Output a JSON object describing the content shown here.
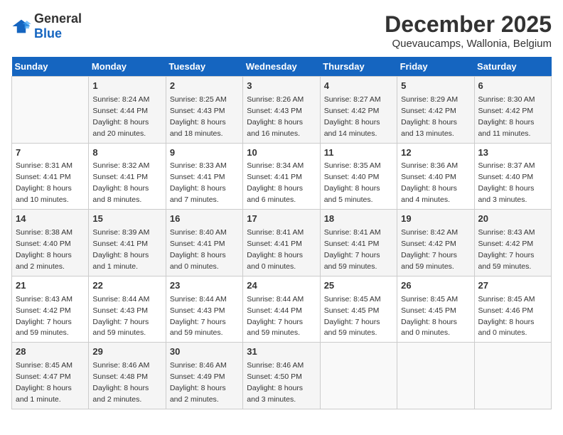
{
  "logo": {
    "general": "General",
    "blue": "Blue"
  },
  "title": "December 2025",
  "subtitle": "Quevaucamps, Wallonia, Belgium",
  "weekdays": [
    "Sunday",
    "Monday",
    "Tuesday",
    "Wednesday",
    "Thursday",
    "Friday",
    "Saturday"
  ],
  "weeks": [
    [
      {
        "day": "",
        "sunrise": "",
        "sunset": "",
        "daylight": ""
      },
      {
        "day": "1",
        "sunrise": "Sunrise: 8:24 AM",
        "sunset": "Sunset: 4:44 PM",
        "daylight": "Daylight: 8 hours and 20 minutes."
      },
      {
        "day": "2",
        "sunrise": "Sunrise: 8:25 AM",
        "sunset": "Sunset: 4:43 PM",
        "daylight": "Daylight: 8 hours and 18 minutes."
      },
      {
        "day": "3",
        "sunrise": "Sunrise: 8:26 AM",
        "sunset": "Sunset: 4:43 PM",
        "daylight": "Daylight: 8 hours and 16 minutes."
      },
      {
        "day": "4",
        "sunrise": "Sunrise: 8:27 AM",
        "sunset": "Sunset: 4:42 PM",
        "daylight": "Daylight: 8 hours and 14 minutes."
      },
      {
        "day": "5",
        "sunrise": "Sunrise: 8:29 AM",
        "sunset": "Sunset: 4:42 PM",
        "daylight": "Daylight: 8 hours and 13 minutes."
      },
      {
        "day": "6",
        "sunrise": "Sunrise: 8:30 AM",
        "sunset": "Sunset: 4:42 PM",
        "daylight": "Daylight: 8 hours and 11 minutes."
      }
    ],
    [
      {
        "day": "7",
        "sunrise": "Sunrise: 8:31 AM",
        "sunset": "Sunset: 4:41 PM",
        "daylight": "Daylight: 8 hours and 10 minutes."
      },
      {
        "day": "8",
        "sunrise": "Sunrise: 8:32 AM",
        "sunset": "Sunset: 4:41 PM",
        "daylight": "Daylight: 8 hours and 8 minutes."
      },
      {
        "day": "9",
        "sunrise": "Sunrise: 8:33 AM",
        "sunset": "Sunset: 4:41 PM",
        "daylight": "Daylight: 8 hours and 7 minutes."
      },
      {
        "day": "10",
        "sunrise": "Sunrise: 8:34 AM",
        "sunset": "Sunset: 4:41 PM",
        "daylight": "Daylight: 8 hours and 6 minutes."
      },
      {
        "day": "11",
        "sunrise": "Sunrise: 8:35 AM",
        "sunset": "Sunset: 4:40 PM",
        "daylight": "Daylight: 8 hours and 5 minutes."
      },
      {
        "day": "12",
        "sunrise": "Sunrise: 8:36 AM",
        "sunset": "Sunset: 4:40 PM",
        "daylight": "Daylight: 8 hours and 4 minutes."
      },
      {
        "day": "13",
        "sunrise": "Sunrise: 8:37 AM",
        "sunset": "Sunset: 4:40 PM",
        "daylight": "Daylight: 8 hours and 3 minutes."
      }
    ],
    [
      {
        "day": "14",
        "sunrise": "Sunrise: 8:38 AM",
        "sunset": "Sunset: 4:40 PM",
        "daylight": "Daylight: 8 hours and 2 minutes."
      },
      {
        "day": "15",
        "sunrise": "Sunrise: 8:39 AM",
        "sunset": "Sunset: 4:41 PM",
        "daylight": "Daylight: 8 hours and 1 minute."
      },
      {
        "day": "16",
        "sunrise": "Sunrise: 8:40 AM",
        "sunset": "Sunset: 4:41 PM",
        "daylight": "Daylight: 8 hours and 0 minutes."
      },
      {
        "day": "17",
        "sunrise": "Sunrise: 8:41 AM",
        "sunset": "Sunset: 4:41 PM",
        "daylight": "Daylight: 8 hours and 0 minutes."
      },
      {
        "day": "18",
        "sunrise": "Sunrise: 8:41 AM",
        "sunset": "Sunset: 4:41 PM",
        "daylight": "Daylight: 7 hours and 59 minutes."
      },
      {
        "day": "19",
        "sunrise": "Sunrise: 8:42 AM",
        "sunset": "Sunset: 4:42 PM",
        "daylight": "Daylight: 7 hours and 59 minutes."
      },
      {
        "day": "20",
        "sunrise": "Sunrise: 8:43 AM",
        "sunset": "Sunset: 4:42 PM",
        "daylight": "Daylight: 7 hours and 59 minutes."
      }
    ],
    [
      {
        "day": "21",
        "sunrise": "Sunrise: 8:43 AM",
        "sunset": "Sunset: 4:42 PM",
        "daylight": "Daylight: 7 hours and 59 minutes."
      },
      {
        "day": "22",
        "sunrise": "Sunrise: 8:44 AM",
        "sunset": "Sunset: 4:43 PM",
        "daylight": "Daylight: 7 hours and 59 minutes."
      },
      {
        "day": "23",
        "sunrise": "Sunrise: 8:44 AM",
        "sunset": "Sunset: 4:43 PM",
        "daylight": "Daylight: 7 hours and 59 minutes."
      },
      {
        "day": "24",
        "sunrise": "Sunrise: 8:44 AM",
        "sunset": "Sunset: 4:44 PM",
        "daylight": "Daylight: 7 hours and 59 minutes."
      },
      {
        "day": "25",
        "sunrise": "Sunrise: 8:45 AM",
        "sunset": "Sunset: 4:45 PM",
        "daylight": "Daylight: 7 hours and 59 minutes."
      },
      {
        "day": "26",
        "sunrise": "Sunrise: 8:45 AM",
        "sunset": "Sunset: 4:45 PM",
        "daylight": "Daylight: 8 hours and 0 minutes."
      },
      {
        "day": "27",
        "sunrise": "Sunrise: 8:45 AM",
        "sunset": "Sunset: 4:46 PM",
        "daylight": "Daylight: 8 hours and 0 minutes."
      }
    ],
    [
      {
        "day": "28",
        "sunrise": "Sunrise: 8:45 AM",
        "sunset": "Sunset: 4:47 PM",
        "daylight": "Daylight: 8 hours and 1 minute."
      },
      {
        "day": "29",
        "sunrise": "Sunrise: 8:46 AM",
        "sunset": "Sunset: 4:48 PM",
        "daylight": "Daylight: 8 hours and 2 minutes."
      },
      {
        "day": "30",
        "sunrise": "Sunrise: 8:46 AM",
        "sunset": "Sunset: 4:49 PM",
        "daylight": "Daylight: 8 hours and 2 minutes."
      },
      {
        "day": "31",
        "sunrise": "Sunrise: 8:46 AM",
        "sunset": "Sunset: 4:50 PM",
        "daylight": "Daylight: 8 hours and 3 minutes."
      },
      {
        "day": "",
        "sunrise": "",
        "sunset": "",
        "daylight": ""
      },
      {
        "day": "",
        "sunrise": "",
        "sunset": "",
        "daylight": ""
      },
      {
        "day": "",
        "sunrise": "",
        "sunset": "",
        "daylight": ""
      }
    ]
  ]
}
